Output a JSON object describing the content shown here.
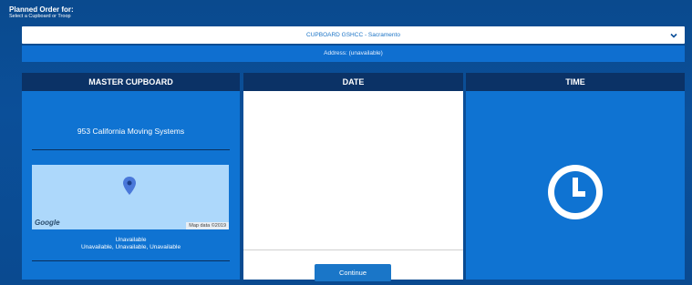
{
  "header": {
    "title": "Planned Order for:",
    "subtitle": "Select a Cupboard or Troop"
  },
  "cupboard_select": {
    "selected": "CUPBOARD GSHCC - Sacramento",
    "icon": "chevron-down-icon"
  },
  "address": "Address: (unavailable)",
  "panels": {
    "master": {
      "heading": "MASTER CUPBOARD",
      "company": "953 California Moving Systems",
      "map": {
        "logo": "Google",
        "attribution": "Map data ©2019",
        "background_color": "#add8fb",
        "pin_color": "#4a78d9",
        "icon": "map-pin-icon"
      },
      "address_line1": "Unavailable",
      "address_line2": "Unavailable, Unavailable, Unavailable"
    },
    "date": {
      "heading": "DATE",
      "continue_label": "Continue"
    },
    "time": {
      "heading": "TIME",
      "icon": "clock-icon"
    }
  },
  "colors": {
    "header_bar": "#0b3266",
    "panel_blue": "#0f73d2",
    "button": "#1a76c8",
    "select_text": "#1a73c6"
  }
}
